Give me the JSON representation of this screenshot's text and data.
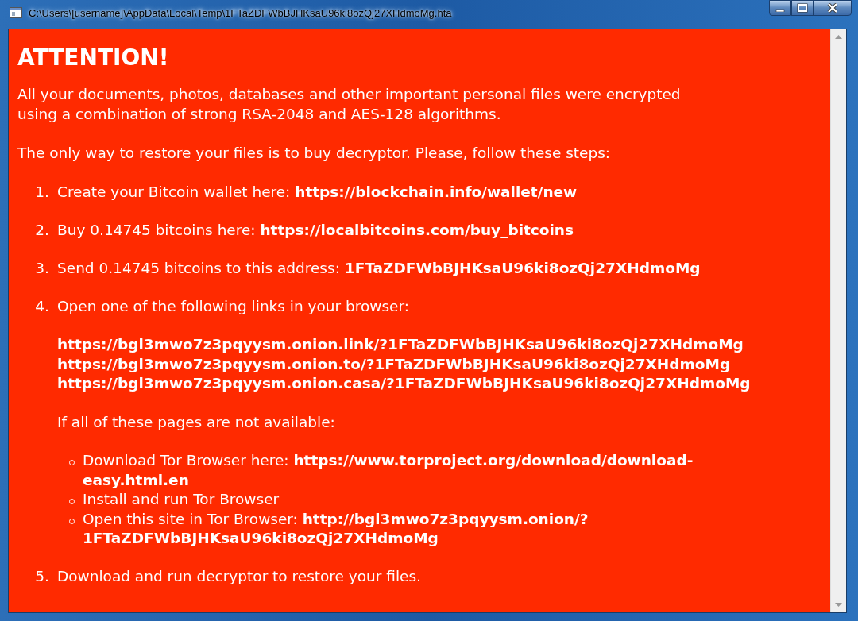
{
  "window": {
    "title": "C:\\Users\\[username]\\AppData\\Local\\Temp\\1FTaZDFWbBJHKsaU96ki8ozQj27XHdmoMg.hta"
  },
  "heading": "ATTENTION!",
  "paragraphs": [
    "All your documents, photos, databases and other important personal files were encrypted\nusing a combination of strong RSA-2048 and AES-128 algorithms.",
    "The only way to restore your files is to buy decryptor. Please, follow these steps:"
  ],
  "steps": [
    {
      "number": "1.",
      "text": "Create your Bitcoin wallet here: **https://blockchain.info/wallet/new**"
    },
    {
      "number": "2.",
      "text": "Buy 0.14745 bitcoins here: **https://localbitcoins.com/buy_bitcoins**"
    },
    {
      "number": "3.",
      "text": "Send 0.14745 bitcoins to this address: **1FTaZDFWbBJHKsaU96ki8ozQj27XHdmoMg**"
    },
    {
      "number": "4.",
      "text": "Open one of the following links in your browser:",
      "links": [
        "https://bgl3mwo7z3pqyysm.onion.link/?1FTaZDFWbBJHKsaU96ki8ozQj27XHdmoMg",
        "https://bgl3mwo7z3pqyysm.onion.to/?1FTaZDFWbBJHKsaU96ki8ozQj27XHdmoMg",
        "https://bgl3mwo7z3pqyysm.onion.casa/?1FTaZDFWbBJHKsaU96ki8ozQj27XHdmoMg"
      ],
      "note": "If all of these pages are not available:",
      "bullets": [
        "Download Tor Browser here: **https://www.torproject.org/download/download-easy.html.en**",
        "Install and run Tor Browser",
        "Open this site in Tor Browser: **http://bgl3mwo7z3pqyysm.onion/?1FTaZDFWbBJHKsaU96ki8ozQj27XHdmoMg**"
      ]
    },
    {
      "number": "5.",
      "text": "Download and run decryptor to restore your files."
    }
  ]
}
